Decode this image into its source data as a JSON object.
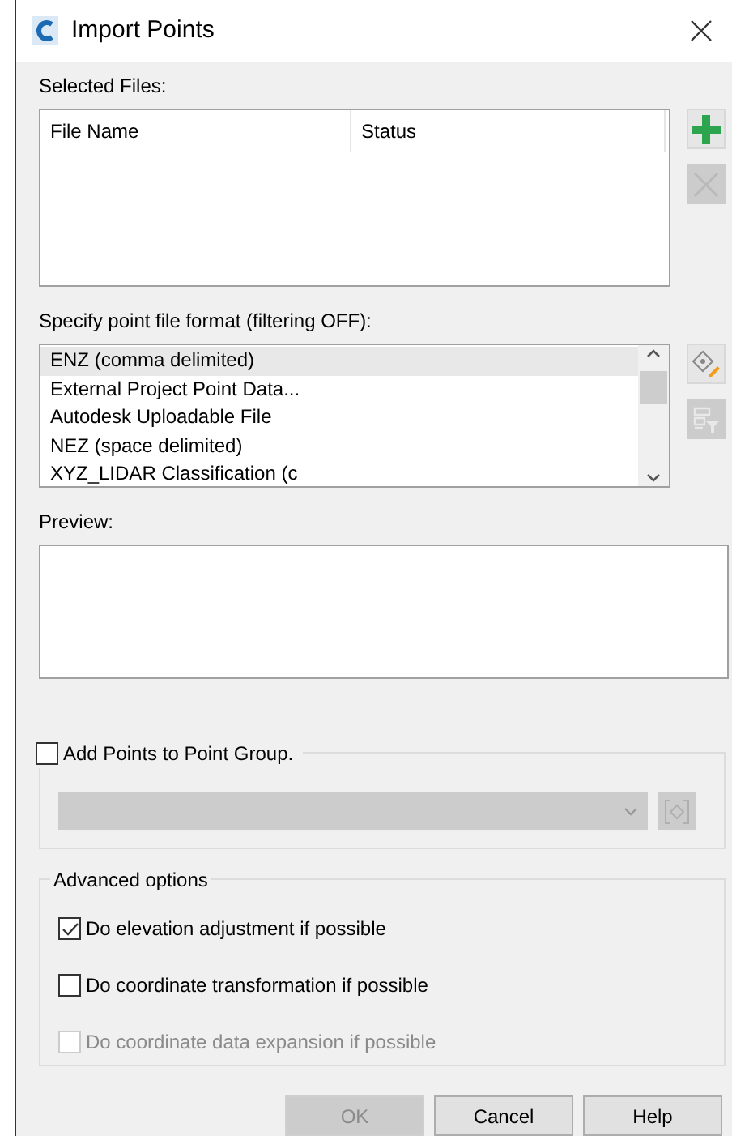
{
  "window": {
    "title": "Import Points"
  },
  "selected_files": {
    "label": "Selected Files:",
    "columns": [
      "File Name",
      "Status"
    ],
    "tools": [
      {
        "kind": "add",
        "disabled": false
      },
      {
        "kind": "remove",
        "disabled": true
      }
    ]
  },
  "format": {
    "label": "Specify point file format (filtering OFF):",
    "items": [
      {
        "label": "ENZ (comma delimited)",
        "selected": true
      },
      {
        "label": "External Project Point Data...",
        "selected": false
      },
      {
        "label": "Autodesk Uploadable File",
        "selected": false
      },
      {
        "label": "NEZ (space delimited)",
        "selected": false
      },
      {
        "label": "XYZ_LIDAR Classification (c",
        "selected": false
      }
    ],
    "tools": [
      {
        "kind": "edit",
        "disabled": false
      },
      {
        "kind": "filter",
        "disabled": true
      }
    ]
  },
  "preview": {
    "label": "Preview:"
  },
  "point_group": {
    "label": "Add Points to Point Group.",
    "checked": false
  },
  "advanced": {
    "title": "Advanced options",
    "options": [
      {
        "label": "Do elevation adjustment if possible",
        "checked": true,
        "disabled": false
      },
      {
        "label": "Do coordinate transformation if possible",
        "checked": false,
        "disabled": false
      },
      {
        "label": "Do coordinate data expansion if possible",
        "checked": false,
        "disabled": true
      }
    ]
  },
  "buttons": [
    {
      "label": "OK",
      "disabled": true
    },
    {
      "label": "Cancel",
      "disabled": false
    },
    {
      "label": "Help",
      "disabled": false
    }
  ]
}
